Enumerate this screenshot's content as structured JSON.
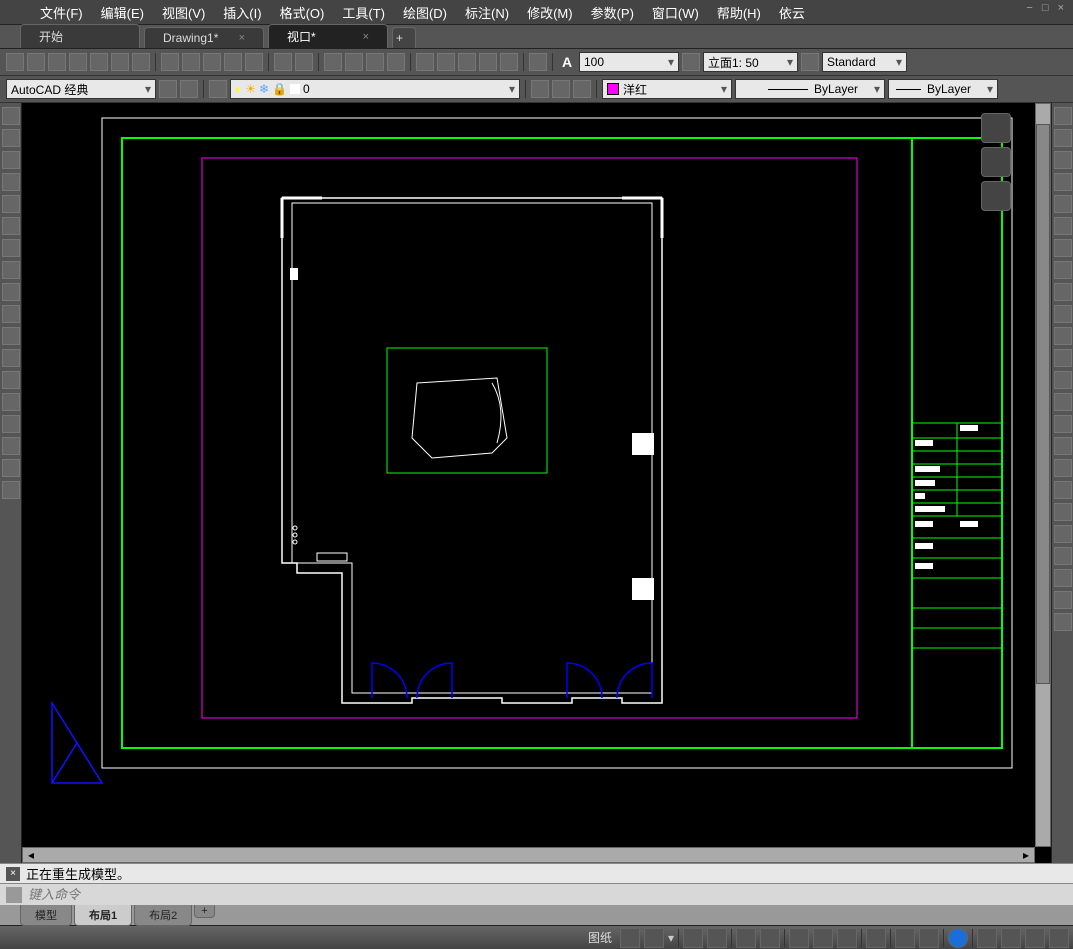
{
  "menus": [
    "文件(F)",
    "编辑(E)",
    "视图(V)",
    "插入(I)",
    "格式(O)",
    "工具(T)",
    "绘图(D)",
    "标注(N)",
    "修改(M)",
    "参数(P)",
    "窗口(W)",
    "帮助(H)",
    "依云"
  ],
  "window_controls": "− □ ×",
  "tabs": [
    {
      "label": "开始",
      "closable": false,
      "active": false
    },
    {
      "label": "Drawing1*",
      "closable": true,
      "active": false
    },
    {
      "label": "视口*",
      "closable": true,
      "active": true
    }
  ],
  "toolbar1": {
    "scale_value": "100",
    "elevation": "立面1: 50",
    "textstyle": "Standard"
  },
  "toolbar2": {
    "workspace": "AutoCAD 经典",
    "layer_state": "0",
    "color": "洋红",
    "linetype": "ByLayer",
    "lineweight": "ByLayer"
  },
  "message": "正在重生成模型。",
  "cmd_placeholder": "键入命令",
  "bottom_tabs": [
    "模型",
    "布局1",
    "布局2"
  ],
  "bottom_active": 1,
  "status": {
    "label": "图纸"
  }
}
